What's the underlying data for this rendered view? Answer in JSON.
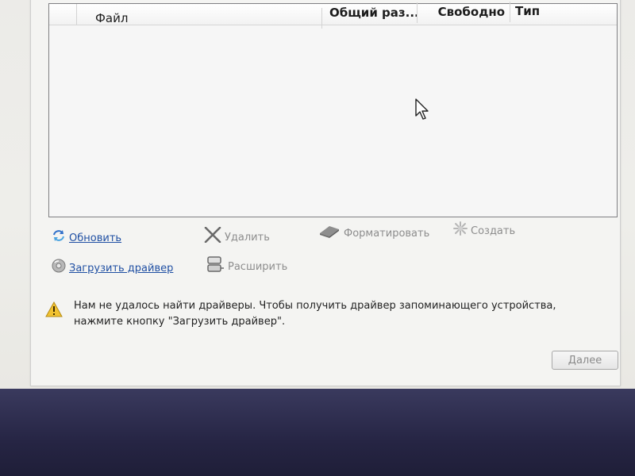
{
  "table": {
    "columns": [
      "Файл",
      "Общий раз...",
      "Свободно",
      "Тип"
    ],
    "rows": []
  },
  "actions": {
    "refresh": {
      "label": "Обновить",
      "icon": "refresh-icon",
      "enabled": true
    },
    "delete": {
      "label": "Удалить",
      "icon": "delete-icon",
      "enabled": false
    },
    "format": {
      "label": "Форматировать",
      "icon": "format-icon",
      "enabled": false
    },
    "create": {
      "label": "Создать",
      "icon": "create-icon",
      "enabled": false
    },
    "load_driver": {
      "label": "Загрузить драйвер",
      "icon": "load-driver-icon",
      "enabled": true
    },
    "extend": {
      "label": "Расширить",
      "icon": "extend-icon",
      "enabled": false
    }
  },
  "warning": {
    "line1": "Нам не удалось найти драйверы. Чтобы получить драйвер запоминающего устройства,",
    "line2": "нажмите кнопку \"Загрузить драйвер\".",
    "icon": "warning-icon"
  },
  "buttons": {
    "next_label": "Далее"
  },
  "colors": {
    "link": "#1f4fa3",
    "disabled": "#8d8d8d",
    "background": "#2e2d4c"
  }
}
